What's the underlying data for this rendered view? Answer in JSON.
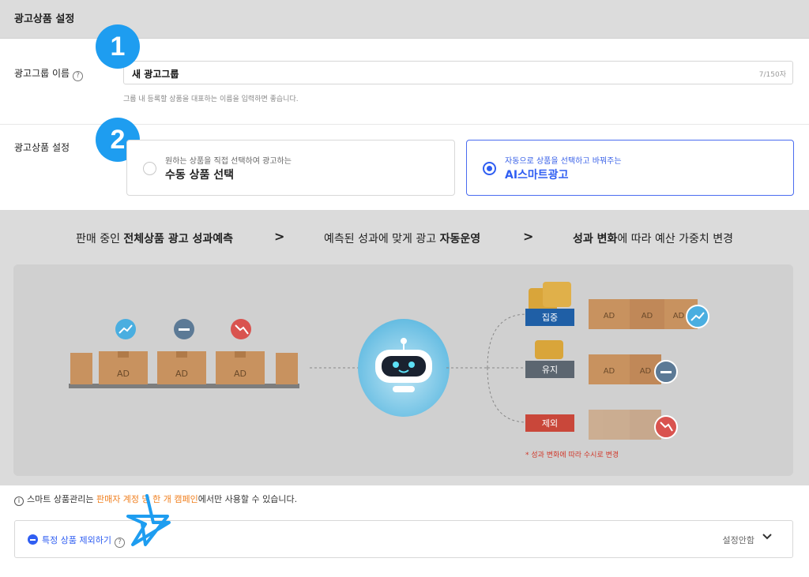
{
  "header": {
    "title": "광고상품 설정"
  },
  "group_name": {
    "label": "광고그룹 이름",
    "value": "새 광고그룹",
    "counter": "7/150자",
    "hint": "그룹 내 등록할 상품을 대표하는 이름을 입력하면 좋습니다."
  },
  "badges": {
    "one": "1",
    "two": "2"
  },
  "product_setting": {
    "label": "광고상품 설정",
    "manual": {
      "sub": "원하는 상품을 직접 선택하여 광고하는",
      "main": "수동 상품 선택",
      "selected": false
    },
    "smart": {
      "sub": "자동으로 상품을 선택하고 바꿔주는",
      "main": "AI스마트광고",
      "selected": true
    }
  },
  "banner": {
    "step1_pre": "판매 중인 ",
    "step1_bold": "전체상품 광고 성과예측",
    "step2_pre": "예측된 성과에 맞게 광고 ",
    "step2_bold": "자동운영",
    "step3_bold": "성과 변화",
    "step3_post": "에 따라 예산 가중치 변경",
    "arrow": ">",
    "ad_text": "AD",
    "tags": {
      "focus": "집중",
      "keep": "유지",
      "exclude": "제외"
    },
    "footnote": "* 성과 변화에 따라 수시로 변경",
    "colors": {
      "focus": "#1f5fa6",
      "keep": "#5c6670",
      "exclude": "#c9473a",
      "box": "#c8925f"
    }
  },
  "notice": {
    "icon": "i",
    "pre": "스마트 상품관리는 ",
    "highlight": "판매자 계정 당 한 개 캠페인",
    "post": "에서만 사용할 수 있습니다."
  },
  "exclude_panel": {
    "label": "특정 상품 제외하기",
    "status": "설정안함"
  }
}
